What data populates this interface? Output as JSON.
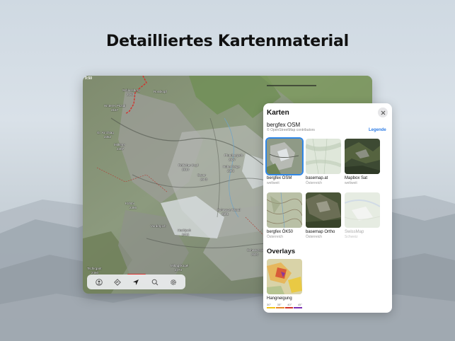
{
  "headline": "Detailliertes Kartenmaterial",
  "status_bar": {
    "time": "9:50"
  },
  "map_labels": [
    "Schlossberg",
    "2163",
    "Rosskopf",
    "Gr. Kirchtag",
    "2352",
    "Hinteres Pitztal",
    "2167",
    "Mittlerer",
    "2307",
    "Rötlicher Kopf",
    "2510",
    "Saxer",
    "2640",
    "Hohe Geige",
    "2393",
    "Pfundserjoch",
    "2527",
    "Kühtai",
    "2386",
    "Schwarze Wand",
    "2591",
    "Vorderjoch",
    "Hochjoch",
    "2416",
    "Tschirgant",
    "2450",
    "Schwarzspitze",
    "2520",
    "Mittagskogel",
    "2473"
  ],
  "toolbar": {
    "items": [
      {
        "name": "profile-button",
        "icon": "person-icon"
      },
      {
        "name": "routes-button",
        "icon": "route-icon"
      },
      {
        "name": "locate-button",
        "icon": "navigation-arrow-icon"
      },
      {
        "name": "search-button",
        "icon": "search-icon"
      },
      {
        "name": "settings-button",
        "icon": "gear-icon"
      }
    ]
  },
  "panel": {
    "title": "Karten",
    "current_source": "bergfex OSM",
    "credit": "© OpenStreetMap contributors",
    "legend_link": "Legende",
    "maps": [
      {
        "name": "bergfex OSM",
        "region": "weltweit",
        "selected": true
      },
      {
        "name": "basemap.at",
        "region": "Österreich",
        "selected": false
      },
      {
        "name": "Mapbox Sat",
        "region": "weltweit",
        "selected": false
      },
      {
        "name": "bergfex ÖK50",
        "region": "Österreich",
        "selected": false
      },
      {
        "name": "basemap Ortho",
        "region": "Österreich",
        "selected": false
      },
      {
        "name": "SwissMap",
        "region": "Schweiz",
        "selected": false,
        "disabled": true
      }
    ],
    "overlays_title": "Overlays",
    "overlays": [
      {
        "name": "Hangneigung",
        "scale": [
          "30°",
          "35°",
          "40°",
          "45°"
        ]
      }
    ]
  },
  "colors": {
    "accent": "#2f86e6",
    "legend_link": "#2c7be5",
    "route": "#d2322d",
    "slope_scale": [
      "#f0c419",
      "#e8862a",
      "#d1332b",
      "#7a2fb2"
    ]
  }
}
